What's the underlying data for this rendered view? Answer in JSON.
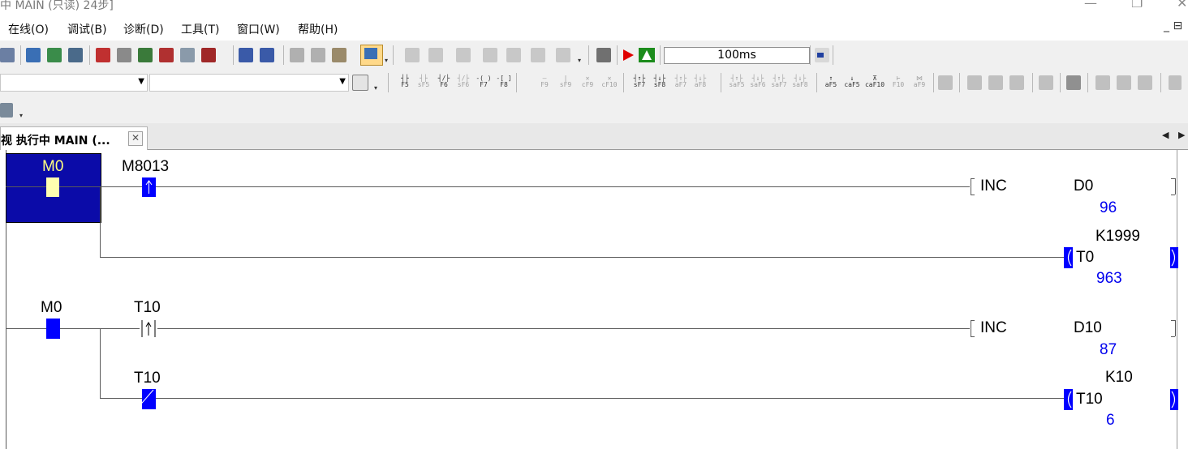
{
  "title_bar": {
    "title": "中 MAIN (只读) 24步]",
    "minimize": "—",
    "maximize": "❐",
    "close": "✕"
  },
  "menu": {
    "items": [
      "在线(O)",
      "调试(B)",
      "诊断(D)",
      "工具(T)",
      "窗口(W)",
      "帮助(H)"
    ],
    "right_controls": "_ ⊟"
  },
  "toolbar": {
    "scan_time": "100ms",
    "function_keys": [
      {
        "top": "┤├",
        "bottom": "F5"
      },
      {
        "top": "┤├",
        "bottom": "sF5"
      },
      {
        "top": "┤/├",
        "bottom": "F6"
      },
      {
        "top": "┤/├",
        "bottom": "sF6"
      },
      {
        "top": "-( )",
        "bottom": "F7"
      },
      {
        "top": "-[ ]",
        "bottom": "F8"
      },
      {
        "top": "—",
        "bottom": "F9"
      },
      {
        "top": "|",
        "bottom": "sF9"
      },
      {
        "top": "✕",
        "bottom": "cF9"
      },
      {
        "top": "✕",
        "bottom": "cF10"
      },
      {
        "top": "┤↑├",
        "bottom": "sF7"
      },
      {
        "top": "┤↓├",
        "bottom": "sF8"
      },
      {
        "top": "┤↑├",
        "bottom": "aF7"
      },
      {
        "top": "┤↓├",
        "bottom": "aF8"
      },
      {
        "top": "┤↑├",
        "bottom": "saF5"
      },
      {
        "top": "┤↓├",
        "bottom": "saF6"
      },
      {
        "top": "┤↑├",
        "bottom": "saF7"
      },
      {
        "top": "┤↓├",
        "bottom": "saF8"
      },
      {
        "top": "↑",
        "bottom": "aF5"
      },
      {
        "top": "↓",
        "bottom": "caF5"
      },
      {
        "top": "⊼",
        "bottom": "caF10"
      },
      {
        "top": "⊢",
        "bottom": "F10"
      },
      {
        "top": "⋈",
        "bottom": "aF9"
      }
    ]
  },
  "tabs": [
    {
      "label": "视 执行中 MAIN (...",
      "close": "✕"
    }
  ],
  "tab_nav": {
    "prev": "◀",
    "next": "▶"
  },
  "ladder": {
    "rung1": {
      "contact1": "M0",
      "contact2": "M8013",
      "instr": "INC",
      "operand": "D0",
      "operand_value": "96",
      "timer_preset": "K1999",
      "timer": "T0",
      "timer_value": "963"
    },
    "rung2": {
      "contact1": "M0",
      "contact2": "T10",
      "instr": "INC",
      "operand": "D10",
      "operand_value": "87",
      "contact3": "T10",
      "timer_preset": "K10",
      "timer": "T10",
      "timer_value": "6"
    }
  },
  "colors": {
    "monitor_blue": "#0000ff",
    "value_blue": "#0000ee",
    "selection": "#0b0ba8",
    "contact_on": "#ffffb0"
  }
}
